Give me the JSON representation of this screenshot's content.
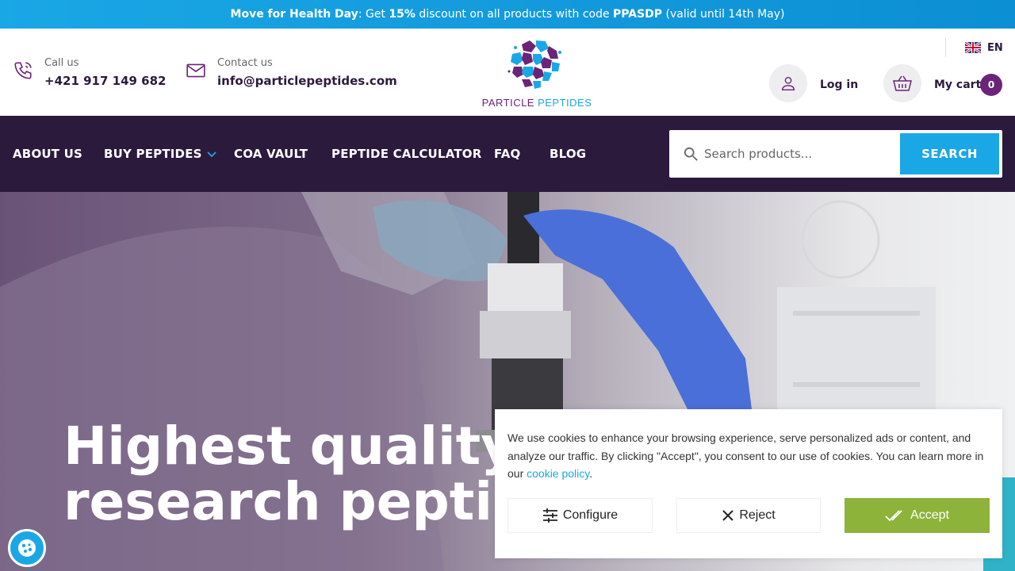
{
  "promo": {
    "event": "Move for Health Day",
    "text1": ": Get ",
    "discount": "15%",
    "text2": " discount on all products with code ",
    "code": "PPASDP",
    "text3": " (valid until 14th May)"
  },
  "header": {
    "call_label": "Call us",
    "phone": "+421 917 149 682",
    "contact_label": "Contact us",
    "email": "info@particlepeptides.com",
    "logo_text_a": "PARTICLE ",
    "logo_text_b": "PEPTIDES",
    "language": "EN",
    "login_label": "Log in",
    "cart_label": "My cart",
    "cart_count": "0"
  },
  "nav": {
    "items": [
      "ABOUT US",
      "BUY PEPTIDES",
      "COA VAULT",
      "PEPTIDE CALCULATOR",
      "FAQ",
      "BLOG"
    ]
  },
  "search": {
    "placeholder": "Search products...",
    "button": "SEARCH"
  },
  "hero": {
    "line1": "Highest quality",
    "line2": "research peptides"
  },
  "cookie": {
    "text": "We use cookies to enhance your browsing experience, serve personalized ads or content, and analyze our traffic. By clicking \"Accept\", you consent to our use of cookies. You can learn more in our ",
    "link": "cookie policy",
    "end": ".",
    "configure": "Configure",
    "reject": "Reject",
    "accept": "Accept"
  },
  "colors": {
    "brand_dark": "#2c1a3d",
    "brand_purple": "#6b2477",
    "accent_blue": "#1aa7e6",
    "accept_green": "#8db33a"
  }
}
